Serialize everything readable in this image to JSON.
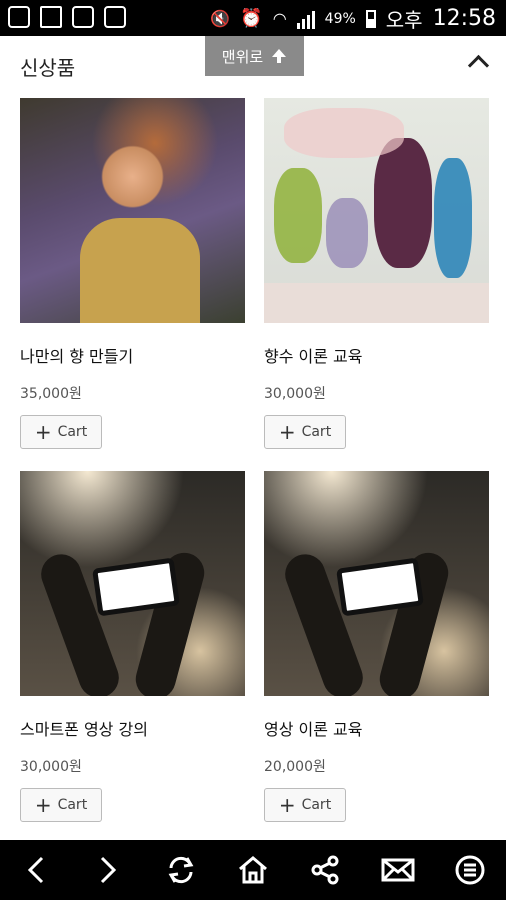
{
  "status_bar": {
    "battery": "49%",
    "ampm": "오후",
    "time": "12:58"
  },
  "header": {
    "title": "신상품",
    "scroll_top_label": "맨위로"
  },
  "products": [
    {
      "name": "나만의 향 만들기",
      "price": "35,000원",
      "cart_label": "Cart",
      "image": "girl-in-lavender-photo"
    },
    {
      "name": "향수 이론 교육",
      "price": "30,000원",
      "cart_label": "Cart",
      "image": "perfume-bottles-photo"
    },
    {
      "name": "스마트폰 영상 강의",
      "price": "30,000원",
      "cart_label": "Cart",
      "image": "concert-phone-photo"
    },
    {
      "name": "영상 이론 교육",
      "price": "20,000원",
      "cart_label": "Cart",
      "image": "concert-phone-photo"
    }
  ],
  "bottom_nav": [
    "back-icon",
    "forward-icon",
    "refresh-icon",
    "home-icon",
    "share-icon",
    "mail-icon",
    "menu-icon"
  ]
}
